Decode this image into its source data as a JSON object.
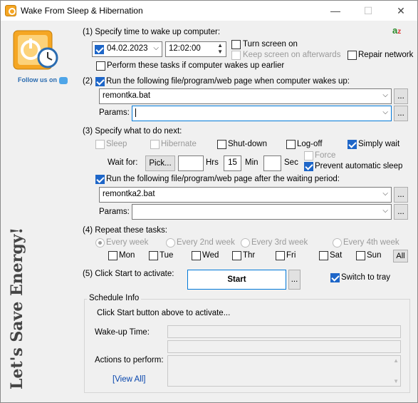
{
  "window": {
    "title": "Wake From Sleep & Hibernation"
  },
  "titlebar": {
    "min": "—",
    "max": "☐",
    "close": "✕"
  },
  "sidebar": {
    "follow_text": "Follow us on",
    "slogan": "Let's Save Energy!"
  },
  "step1": {
    "label": "(1) Specify time to wake up computer:",
    "date": "04.02.2023",
    "time": "12:02:00",
    "turn_screen_on": "Turn screen on",
    "keep_screen_on": "Keep screen on afterwards",
    "repair_network": "Repair network",
    "perform_on_wake": "Perform these tasks if computer wakes up earlier"
  },
  "step2": {
    "label": "Run the following file/program/web page when computer wakes up:",
    "prefix": "(2)",
    "file": "remontka.bat",
    "params_label": "Params:",
    "params_value": "",
    "browse": "..."
  },
  "step3": {
    "label": "(3) Specify what to do next:",
    "sleep": "Sleep",
    "hibernate": "Hibernate",
    "shutdown": "Shut-down",
    "logoff": "Log-off",
    "simply_wait": "Simply wait",
    "wait_for": "Wait for:",
    "pick": "Pick...",
    "hrs_value": "",
    "hrs": "Hrs",
    "min_value": "15",
    "min": "Min",
    "sec_value": "",
    "sec": "Sec",
    "force": "Force",
    "prevent_sleep": "Prevent automatic sleep",
    "run_after": "Run the following file/program/web page after the waiting period:",
    "file": "remontka2.bat",
    "params_label": "Params:",
    "params_value": "",
    "browse": "..."
  },
  "step4": {
    "label": "(4) Repeat these tasks:",
    "every_week": "Every week",
    "every_2nd": "Every 2nd week",
    "every_3rd": "Every 3rd week",
    "every_4th": "Every 4th week",
    "days": [
      "Mon",
      "Tue",
      "Wed",
      "Thr",
      "Fri",
      "Sat",
      "Sun"
    ],
    "all": "All"
  },
  "step5": {
    "label": "(5) Click Start to activate:",
    "start": "Start",
    "more": "...",
    "switch_tray": "Switch to tray"
  },
  "schedule": {
    "title": "Schedule Info",
    "hint": "Click Start button above to activate...",
    "wake_label": "Wake-up Time:",
    "actions_label": "Actions to perform:",
    "view_all": "[View All]"
  }
}
